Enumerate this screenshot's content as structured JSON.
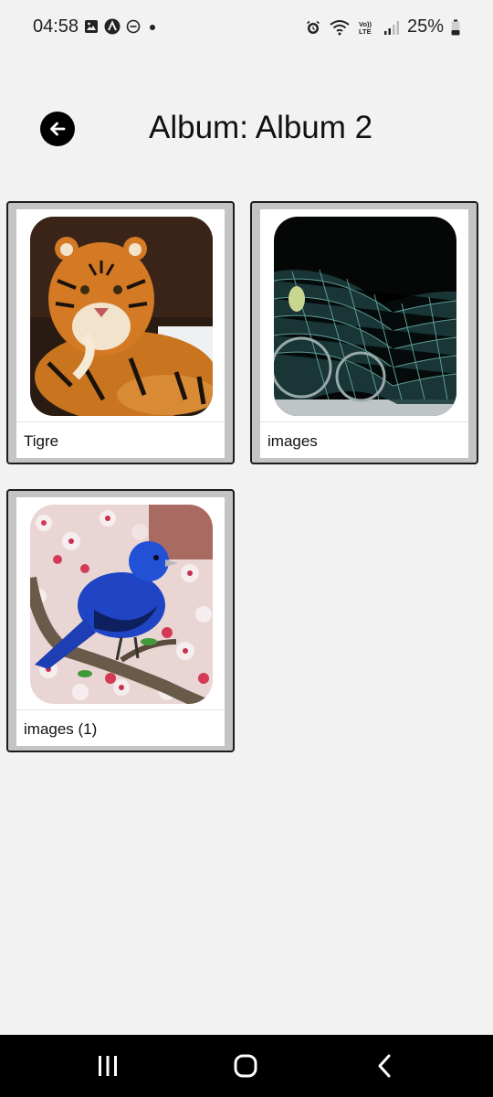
{
  "status_bar": {
    "time": "04:58",
    "battery": "25%",
    "icons": [
      "image-icon",
      "app-icon",
      "do-not-disturb-icon",
      "dot-icon",
      "alarm-icon",
      "wifi-icon",
      "volte-icon",
      "signal-icon",
      "battery-icon"
    ]
  },
  "header": {
    "title": "Album: Album 2",
    "back_icon": "arrow-left-icon"
  },
  "photos": [
    {
      "label": "Tigre",
      "image": "tiger photo"
    },
    {
      "label": "images",
      "image": "motorcycle mesh sculpture photo"
    },
    {
      "label": "images (1)",
      "image": "blue bird on blossoming branch photo"
    }
  ],
  "nav_bar": {
    "icons": [
      "recent-apps-icon",
      "home-icon",
      "back-icon"
    ]
  },
  "colors": {
    "background": "#f2f2f2",
    "card_border": "#1c1c1c",
    "card_frame": "#c4c4c4",
    "nav_bar": "#000000"
  }
}
